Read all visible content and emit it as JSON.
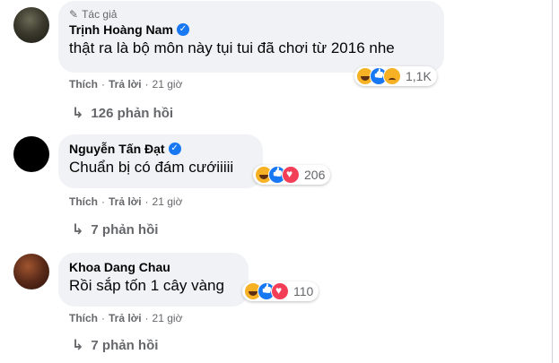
{
  "comments": [
    {
      "author_tag": "Tác giả",
      "name": "Trịnh Hoàng Nam",
      "verified": true,
      "text": "thật ra là bộ môn này tụi tui đã chơi từ 2016 nhe",
      "reactions": [
        "haha",
        "like",
        "sad"
      ],
      "reaction_count": "1,1K",
      "actions": {
        "like": "Thích",
        "reply": "Trả lời",
        "time": "21 giờ"
      },
      "replies_label": "126 phản hồi"
    },
    {
      "name": "Nguyễn Tấn Đạt",
      "verified": true,
      "text": "Chuẩn bị có đám cướiiiii",
      "reactions": [
        "haha",
        "like",
        "love"
      ],
      "reaction_count": "206",
      "actions": {
        "like": "Thích",
        "reply": "Trả lời",
        "time": "21 giờ"
      },
      "replies_label": "7 phản hồi"
    },
    {
      "name": "Khoa Dang Chau",
      "verified": false,
      "text": "Rồi sắp tốn 1 cây vàng",
      "reactions": [
        "haha",
        "like",
        "love"
      ],
      "reaction_count": "110",
      "actions": {
        "like": "Thích",
        "reply": "Trả lời",
        "time": "21 giờ"
      },
      "replies_label": "7 phản hồi"
    }
  ],
  "separator": "·",
  "colors": {
    "bubble": "#f0f2f5",
    "meta": "#65676b",
    "verified": "#1877f2"
  }
}
